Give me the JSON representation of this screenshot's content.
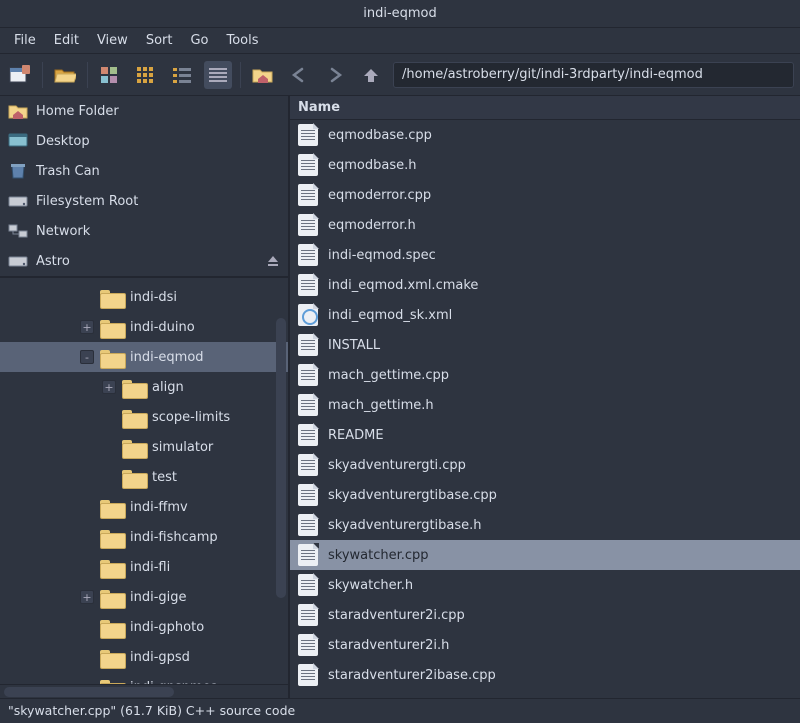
{
  "window": {
    "title": "indi-eqmod"
  },
  "menubar": [
    "File",
    "Edit",
    "View",
    "Sort",
    "Go",
    "Tools"
  ],
  "toolbar": {
    "path": "/home/astroberry/git/indi-3rdparty/indi-eqmod"
  },
  "places": [
    {
      "name": "Home Folder",
      "icon": "home"
    },
    {
      "name": "Desktop",
      "icon": "desktop"
    },
    {
      "name": "Trash Can",
      "icon": "trash"
    },
    {
      "name": "Filesystem Root",
      "icon": "drive"
    },
    {
      "name": "Network",
      "icon": "network"
    },
    {
      "name": "Astro",
      "icon": "drive",
      "eject": true
    }
  ],
  "tree": [
    {
      "indent": 3,
      "label": "indi-dsi",
      "exp": ""
    },
    {
      "indent": 3,
      "label": "indi-duino",
      "exp": "+"
    },
    {
      "indent": 3,
      "label": "indi-eqmod",
      "exp": "-",
      "selected": true
    },
    {
      "indent": 4,
      "label": "align",
      "exp": "+"
    },
    {
      "indent": 4,
      "label": "scope-limits",
      "exp": ""
    },
    {
      "indent": 4,
      "label": "simulator",
      "exp": ""
    },
    {
      "indent": 4,
      "label": "test",
      "exp": ""
    },
    {
      "indent": 3,
      "label": "indi-ffmv",
      "exp": ""
    },
    {
      "indent": 3,
      "label": "indi-fishcamp",
      "exp": ""
    },
    {
      "indent": 3,
      "label": "indi-fli",
      "exp": ""
    },
    {
      "indent": 3,
      "label": "indi-gige",
      "exp": "+"
    },
    {
      "indent": 3,
      "label": "indi-gphoto",
      "exp": ""
    },
    {
      "indent": 3,
      "label": "indi-gpsd",
      "exp": ""
    },
    {
      "indent": 3,
      "label": "indi-gpsnmea",
      "exp": ""
    }
  ],
  "list": {
    "column_header": "Name",
    "rows": [
      {
        "name": "eqmodbase.cpp",
        "icon": "doc"
      },
      {
        "name": "eqmodbase.h",
        "icon": "doc"
      },
      {
        "name": "eqmoderror.cpp",
        "icon": "doc"
      },
      {
        "name": "eqmoderror.h",
        "icon": "doc"
      },
      {
        "name": "indi-eqmod.spec",
        "icon": "doc"
      },
      {
        "name": "indi_eqmod.xml.cmake",
        "icon": "doc"
      },
      {
        "name": "indi_eqmod_sk.xml",
        "icon": "xml"
      },
      {
        "name": "INSTALL",
        "icon": "doc"
      },
      {
        "name": "mach_gettime.cpp",
        "icon": "doc"
      },
      {
        "name": "mach_gettime.h",
        "icon": "doc"
      },
      {
        "name": "README",
        "icon": "doc"
      },
      {
        "name": "skyadventurergti.cpp",
        "icon": "doc"
      },
      {
        "name": "skyadventurergtibase.cpp",
        "icon": "doc"
      },
      {
        "name": "skyadventurergtibase.h",
        "icon": "doc"
      },
      {
        "name": "skywatcher.cpp",
        "icon": "doc",
        "selected": true
      },
      {
        "name": "skywatcher.h",
        "icon": "doc"
      },
      {
        "name": "staradventurer2i.cpp",
        "icon": "doc"
      },
      {
        "name": "staradventurer2i.h",
        "icon": "doc"
      },
      {
        "name": "staradventurer2ibase.cpp",
        "icon": "doc"
      }
    ]
  },
  "statusbar": "\"skywatcher.cpp\" (61.7 KiB) C++ source code"
}
